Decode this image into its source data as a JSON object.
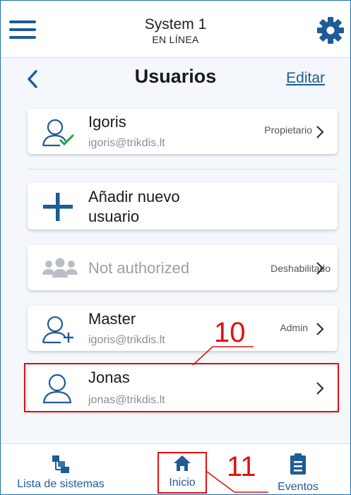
{
  "topbar": {
    "menu_icon": "hamburger-menu-icon",
    "system_name": "System 1",
    "status": "EN LÍNEA",
    "settings_icon": "gear-icon"
  },
  "header": {
    "back_icon": "chevron-left-icon",
    "title": "Usuarios",
    "edit_label": "Editar"
  },
  "users": [
    {
      "name": "Igoris",
      "email": "igoris@trikdis.lt",
      "role": "Propietario",
      "icon": "user-check-icon"
    },
    {
      "name": "Añadir nuevo usuario",
      "icon": "plus-icon"
    },
    {
      "name": "Not authorized",
      "role": "Deshabilitado",
      "icon": "users-group-icon"
    },
    {
      "name": "Master",
      "email": "igoris@trikdis.lt",
      "role": "Admin",
      "icon": "user-add-icon"
    },
    {
      "name": "Jonas",
      "email": "jonas@trikdis.lt",
      "icon": "user-icon"
    }
  ],
  "add_user_lines": [
    "Añadir nuevo",
    "usuario"
  ],
  "callouts": {
    "user_item": "10",
    "home_tab": "11"
  },
  "bottom_nav": [
    {
      "label": "Lista de sistemas",
      "icon": "systems-list-icon"
    },
    {
      "label": "Inicio",
      "icon": "home-icon"
    },
    {
      "label": "Eventos",
      "icon": "clipboard-icon"
    }
  ],
  "colors": {
    "accent": "#1e5b97",
    "green_check": "#2ea84a",
    "callout": "#e01010",
    "muted": "#8a8f96"
  }
}
